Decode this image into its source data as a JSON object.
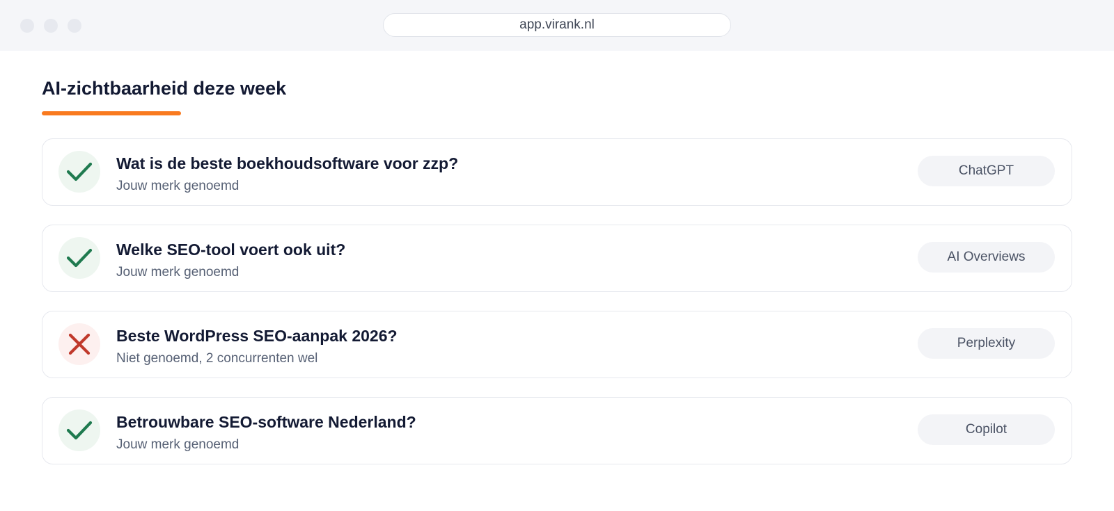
{
  "browser": {
    "url": "app.virank.nl"
  },
  "page": {
    "title": "AI-zichtbaarheid deze week",
    "accent_color": "#f97a1f"
  },
  "colors": {
    "success": "#1f7a4f",
    "error": "#c0392b"
  },
  "rows": [
    {
      "status": "mentioned",
      "status_icon": "check-icon",
      "question": "Wat is de beste boekhoudsoftware voor zzp?",
      "result": "Jouw merk genoemd",
      "engine": "ChatGPT"
    },
    {
      "status": "mentioned",
      "status_icon": "check-icon",
      "question": "Welke SEO-tool voert ook uit?",
      "result": "Jouw merk genoemd",
      "engine": "AI Overviews"
    },
    {
      "status": "not-mentioned",
      "status_icon": "cross-icon",
      "question": "Beste WordPress SEO-aanpak 2026?",
      "result": "Niet genoemd, 2 concurrenten wel",
      "engine": "Perplexity"
    },
    {
      "status": "mentioned",
      "status_icon": "check-icon",
      "question": "Betrouwbare SEO-software Nederland?",
      "result": "Jouw merk genoemd",
      "engine": "Copilot"
    }
  ]
}
